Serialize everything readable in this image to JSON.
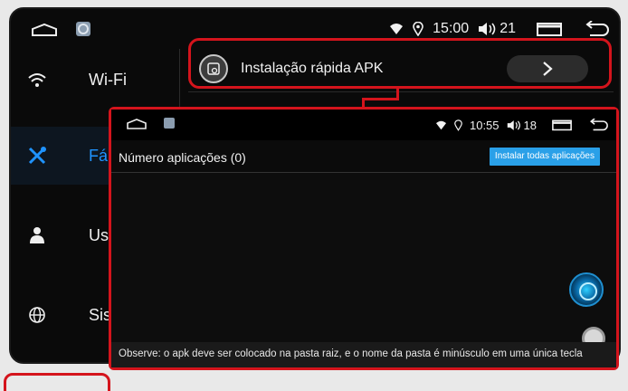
{
  "back_screen": {
    "status": {
      "time": "15:00",
      "volume": "21"
    },
    "sidebar": {
      "items": [
        {
          "label": "Wi-Fi",
          "icon": "wifi-icon"
        },
        {
          "label": "Fábr",
          "icon": "tools-icon",
          "active": true
        },
        {
          "label": "Usua",
          "icon": "user-icon"
        },
        {
          "label": "Siste",
          "icon": "globe-icon"
        }
      ]
    },
    "main": {
      "items": [
        {
          "label": "Instalação rápida APK",
          "icon": "apk-install-icon",
          "action": "chevron-right-icon"
        },
        {
          "label": "",
          "icon": "settings-item-icon"
        }
      ]
    }
  },
  "front_screen": {
    "status": {
      "time": "10:55",
      "volume": "18"
    },
    "title": "Número aplicações (0)",
    "install_all_label": "Instalar todas aplicações",
    "footer_note": "Observe: o apk deve ser colocado na pasta raiz, e o nome da pasta é minúsculo em uma única tecla"
  },
  "colors": {
    "highlight": "#d4141c",
    "active_accent": "#1f93ff",
    "install_button": "#2aa0e8"
  }
}
